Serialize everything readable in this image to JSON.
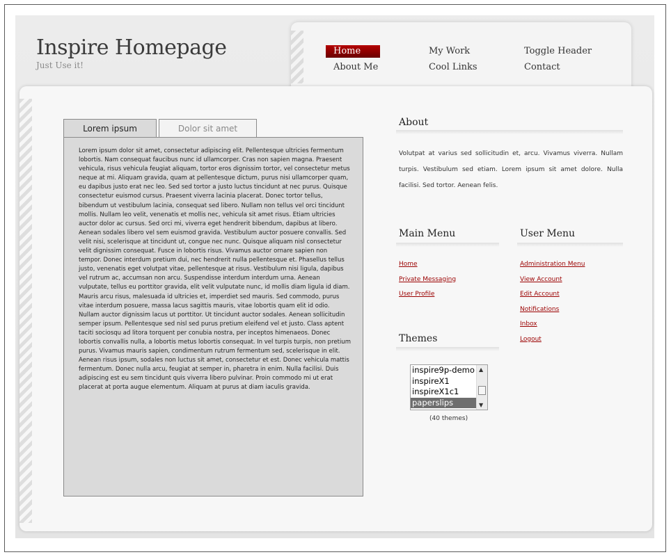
{
  "header": {
    "title": "Inspire Homepage",
    "subtitle": "Just Use it!"
  },
  "nav": {
    "items": [
      {
        "label": "Home",
        "active": true
      },
      {
        "label": "My Work"
      },
      {
        "label": "Toggle Header"
      },
      {
        "label": "About Me"
      },
      {
        "label": "Cool Links"
      },
      {
        "label": "Contact"
      }
    ]
  },
  "tabs": [
    {
      "label": "Lorem ipsum",
      "active": true
    },
    {
      "label": "Dolor sit amet"
    }
  ],
  "tab_content": "Lorem ipsum dolor sit amet, consectetur adipiscing elit. Pellentesque ultricies fermentum lobortis. Nam consequat faucibus nunc id ullamcorper. Cras non sapien magna. Praesent vehicula, risus vehicula feugiat aliquam, tortor eros dignissim tortor, vel consectetur metus neque at mi. Aliquam gravida, quam at pellentesque dictum, purus nisi ullamcorper quam, eu dapibus justo erat nec leo. Sed sed tortor a justo luctus tincidunt at nec purus. Quisque consectetur euismod cursus. Praesent viverra lacinia placerat. Donec tortor tellus, bibendum ut vestibulum lacinia, consequat sed libero. Nullam non tellus vel orci tincidunt mollis. Nullam leo velit, venenatis et mollis nec, vehicula sit amet risus. Etiam ultricies auctor dolor ac cursus. Sed orci mi, viverra eget hendrerit bibendum, dapibus at libero. Aenean sodales libero vel sem euismod gravida. Vestibulum auctor posuere convallis. Sed velit nisi, scelerisque at tincidunt ut, congue nec nunc. Quisque aliquam nisl consectetur velit dignissim consequat. Fusce in lobortis risus. Vivamus auctor ornare sapien non tempor. Donec interdum pretium dui, nec hendrerit nulla pellentesque et. Phasellus tellus justo, venenatis eget volutpat vitae, pellentesque at risus. Vestibulum nisi ligula, dapibus vel rutrum ac, accumsan non arcu. Suspendisse interdum interdum urna. Aenean vulputate, tellus eu porttitor gravida, elit velit vulputate nunc, id mollis diam ligula id diam. Mauris arcu risus, malesuada id ultricies et, imperdiet sed mauris. Sed commodo, purus vitae interdum posuere, massa lacus sagittis mauris, vitae lobortis quam elit id odio. Nullam auctor dignissim lacus ut porttitor. Ut tincidunt auctor sodales. Aenean sollicitudin semper ipsum. Pellentesque sed nisl sed purus pretium eleifend vel et justo. Class aptent taciti sociosqu ad litora torquent per conubia nostra, per inceptos himenaeos. Donec lobortis convallis nulla, a lobortis metus lobortis consequat. In vel turpis turpis, non pretium purus. Vivamus mauris sapien, condimentum rutrum fermentum sed, scelerisque in elit. Aenean risus ipsum, sodales non luctus sit amet, consectetur et est. Donec vehicula mattis fermentum. Donec nulla arcu, feugiat at semper in, pharetra in enim. Nulla facilisi. Duis adipiscing est eu sem tincidunt quis viverra libero pulvinar. Proin commodo mi ut erat placerat at porta augue elementum. Aliquam at purus at diam iaculis gravida.",
  "about": {
    "title": "About",
    "text": "Volutpat at varius sed sollicitudin et, arcu. Vivamus viverra. Nullam turpis. Vestibulum sed etiam. Lorem ipsum sit amet dolore. Nulla facilisi. Sed tortor. Aenean felis."
  },
  "main_menu": {
    "title": "Main Menu",
    "items": [
      "Home",
      "Private Messaging",
      "User Profile"
    ]
  },
  "user_menu": {
    "title": "User Menu",
    "items": [
      "Administration Menu",
      "View Account",
      "Edit Account",
      "Notifications",
      "Inbox",
      "Logout"
    ]
  },
  "themes": {
    "title": "Themes",
    "options": [
      "inspire9p-demo",
      "inspireX1",
      "inspireX1c1",
      "paperslips"
    ],
    "selected": "paperslips",
    "count_label": "(40 themes)"
  },
  "colors": {
    "accent": "#9b0000",
    "nav_active": "#b40000",
    "panel_bg": "#dadada"
  }
}
